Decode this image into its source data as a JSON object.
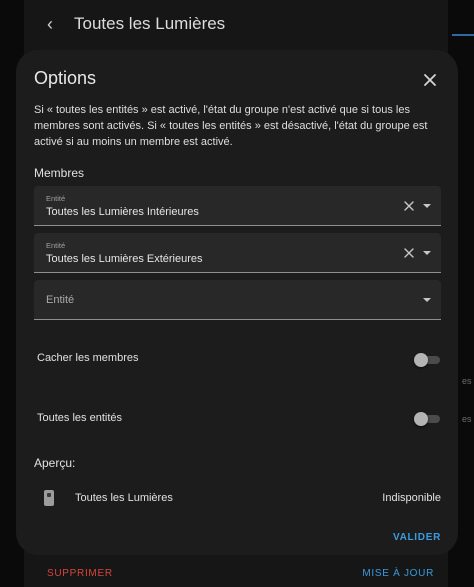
{
  "background": {
    "back_icon": "arrow-left-icon",
    "title": "Toutes les Lumières",
    "delete_label": "SUPPRIMER",
    "update_label": "MISE À JOUR",
    "edge_text_1": "es",
    "edge_text_2": "es"
  },
  "dialog": {
    "title": "Options",
    "close_icon": "close-icon",
    "description": "Si « toutes les entités » est activé, l'état du groupe n'est activé que si tous les membres sont activés. Si « toutes les entités » est désactivé, l'état du groupe est activé si au moins un membre est activé.",
    "members_label": "Membres",
    "members": [
      {
        "label": "Entité",
        "value": "Toutes les Lumières Intérieures"
      },
      {
        "label": "Entité",
        "value": "Toutes les Lumières Extérieures"
      }
    ],
    "empty_member": {
      "placeholder": "Entité"
    },
    "hide_members": {
      "label": "Cacher les membres",
      "checked": false
    },
    "all_entities": {
      "label": "Toutes les entités",
      "checked": false
    },
    "preview_label": "Aperçu:",
    "preview": {
      "icon": "light-switch-icon",
      "name": "Toutes les Lumières",
      "state": "Indisponible"
    },
    "validate_label": "VALIDER"
  },
  "colors": {
    "accent": "#3a9be0",
    "danger": "#d8443d",
    "dialog_bg": "#1c1c1c",
    "field_bg": "#282828"
  }
}
